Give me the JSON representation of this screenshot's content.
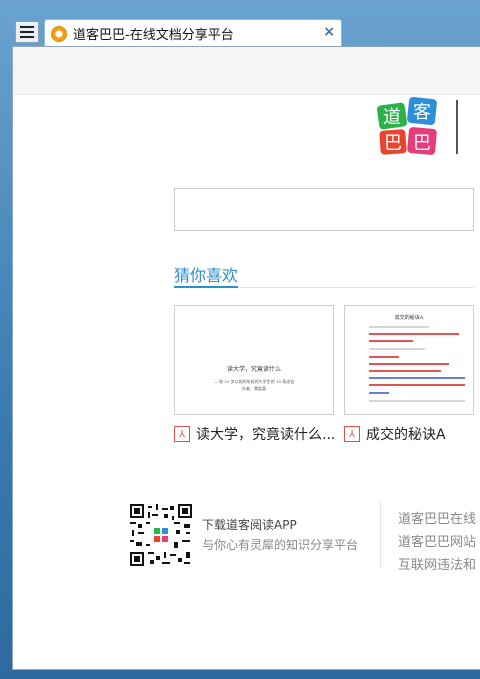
{
  "browser": {
    "tab_title": "道客巴巴-在线文档分享平台",
    "tab_close": "×"
  },
  "recommend": {
    "title": "猜你喜欢",
    "docs": [
      {
        "label": "读大学，究竟读什么...",
        "thumb_title": "读大学，究竟读什么",
        "thumb_sub": "— 给 25 岁以前的年轻的大学生的 15 条忠告",
        "thumb_sub2": "作者：覃彪喜",
        "icon": "pdf-icon"
      },
      {
        "label": "成交的秘诀A",
        "thumb_title": "成交的秘诀A",
        "icon": "pdf-icon"
      }
    ]
  },
  "app_promo": {
    "title": "下载道客阅读APP",
    "subtitle": "与你心有灵犀的知识分享平台"
  },
  "footer": {
    "lines": [
      "道客巴巴在线",
      "道客巴巴网站",
      "互联网违法和"
    ]
  },
  "colors": {
    "accent": "#2a8fd0",
    "pdf_red": "#d9534f"
  }
}
